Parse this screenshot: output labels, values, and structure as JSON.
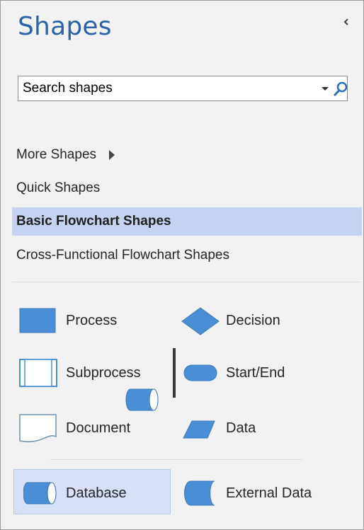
{
  "panel": {
    "title": "Shapes"
  },
  "search": {
    "placeholder": "Search shapes"
  },
  "menu": {
    "more_shapes": "More Shapes",
    "quick_shapes": "Quick Shapes",
    "basic_flowchart": "Basic Flowchart Shapes",
    "cross_functional": "Cross-Functional Flowchart Shapes"
  },
  "shapes": {
    "process": "Process",
    "decision": "Decision",
    "subprocess": "Subprocess",
    "start_end": "Start/End",
    "document": "Document",
    "data": "Data",
    "database": "Database",
    "external_data": "External Data"
  },
  "colors": {
    "shape_fill": "#4a8fd6",
    "shape_stroke": "#3a77ba",
    "title": "#2b63a8",
    "selected_bg": "#c5d3f0"
  }
}
